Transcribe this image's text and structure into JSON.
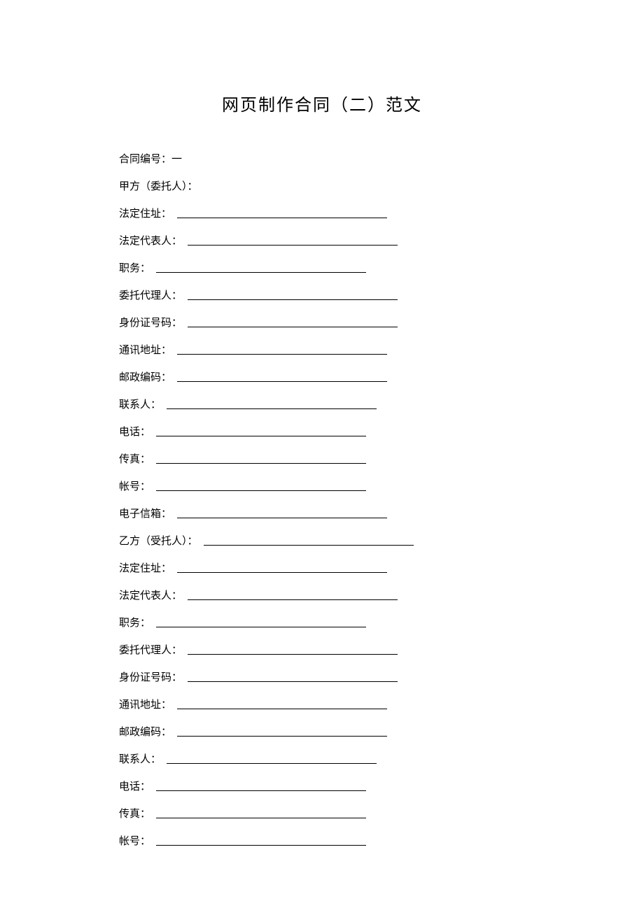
{
  "title": "网页制作合同（二）范文",
  "fields": [
    {
      "label": "合同编号：一",
      "hasLine": false
    },
    {
      "label": "甲方（委托人）：",
      "hasLine": false
    },
    {
      "label": "法定住址：",
      "hasLine": true
    },
    {
      "label": "法定代表人：",
      "hasLine": true
    },
    {
      "label": "职务：",
      "hasLine": true
    },
    {
      "label": "委托代理人：",
      "hasLine": true
    },
    {
      "label": "身份证号码：",
      "hasLine": true
    },
    {
      "label": "通讯地址：",
      "hasLine": true
    },
    {
      "label": "邮政编码：",
      "hasLine": true
    },
    {
      "label": "联系人：",
      "hasLine": true
    },
    {
      "label": "电话：",
      "hasLine": true
    },
    {
      "label": "传真：",
      "hasLine": true
    },
    {
      "label": "帐号：",
      "hasLine": true
    },
    {
      "label": "电子信箱：",
      "hasLine": true
    },
    {
      "label": "乙方（受托人）：",
      "hasLine": true
    },
    {
      "label": "法定住址：",
      "hasLine": true
    },
    {
      "label": "法定代表人：",
      "hasLine": true
    },
    {
      "label": "职务：",
      "hasLine": true
    },
    {
      "label": "委托代理人：",
      "hasLine": true
    },
    {
      "label": "身份证号码：",
      "hasLine": true
    },
    {
      "label": "通讯地址：",
      "hasLine": true
    },
    {
      "label": "邮政编码：",
      "hasLine": true
    },
    {
      "label": "联系人：",
      "hasLine": true
    },
    {
      "label": "电话：",
      "hasLine": true
    },
    {
      "label": "传真：",
      "hasLine": true
    },
    {
      "label": "帐号：",
      "hasLine": true
    }
  ]
}
